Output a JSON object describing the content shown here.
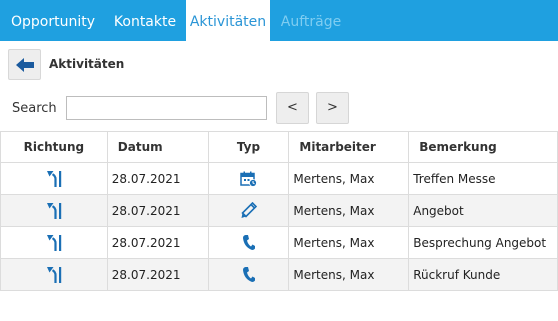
{
  "tabs": [
    {
      "label": "Opportunity",
      "state": "normal"
    },
    {
      "label": "Kontakte",
      "state": "normal"
    },
    {
      "label": "Aktivitäten",
      "state": "active"
    },
    {
      "label": "Aufträge",
      "state": "disabled"
    }
  ],
  "header": {
    "back_icon": "arrow-left-icon",
    "title": "Aktivitäten"
  },
  "search": {
    "label": "Search",
    "value": "",
    "prev_label": "<",
    "next_label": ">"
  },
  "table": {
    "columns": [
      "Richtung",
      "Datum",
      "Typ",
      "Mitarbeiter",
      "Bemerkung"
    ],
    "rows": [
      {
        "direction_icon": "incoming-arrow-icon",
        "date": "28.07.2021",
        "type_icon": "calendar-icon",
        "employee": "Mertens, Max",
        "remark": "Treffen Messe"
      },
      {
        "direction_icon": "incoming-arrow-icon",
        "date": "28.07.2021",
        "type_icon": "pencil-icon",
        "employee": "Mertens, Max",
        "remark": "Angebot"
      },
      {
        "direction_icon": "incoming-arrow-icon",
        "date": "28.07.2021",
        "type_icon": "phone-icon",
        "employee": "Mertens, Max",
        "remark": "Besprechung Angebot"
      },
      {
        "direction_icon": "incoming-arrow-icon",
        "date": "28.07.2021",
        "type_icon": "phone-icon",
        "employee": "Mertens, Max",
        "remark": "Rückruf Kunde"
      }
    ]
  },
  "colors": {
    "tab_bar": "#1fa0e0",
    "active_tab_text": "#2a95d6",
    "icon": "#1a6fb5"
  }
}
